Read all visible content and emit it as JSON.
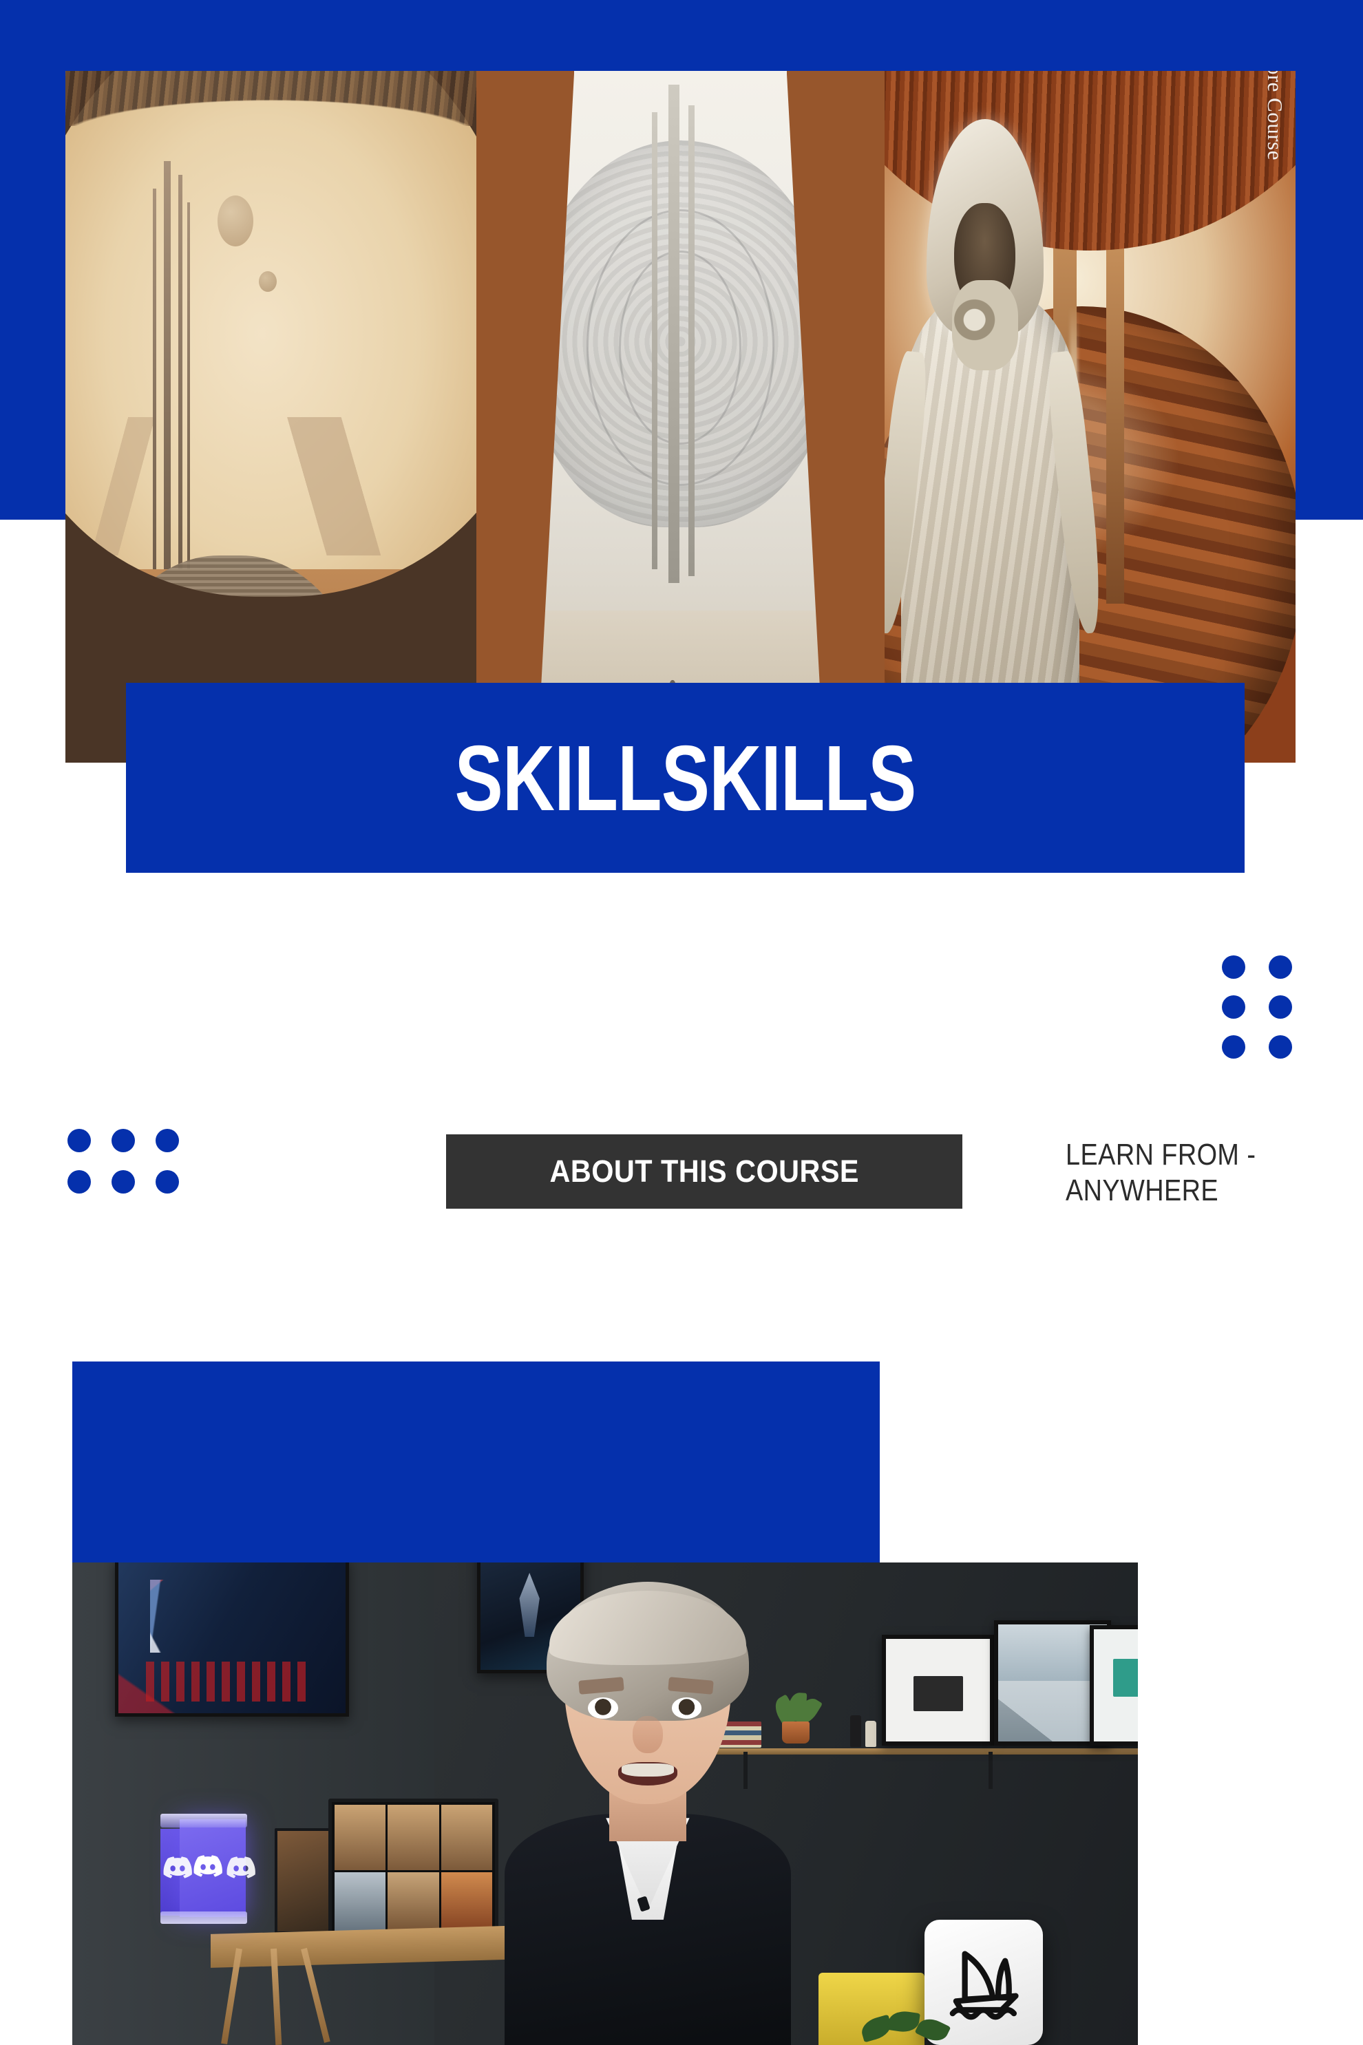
{
  "brand": {
    "name": "SKILLSKILLS",
    "accent_color": "#0530AC",
    "dark_color": "#333333"
  },
  "hero": {
    "watermark": "Skillskills.com For More Course",
    "image_alt": "Three-panel sci-fi desert collage: arched alien city, white megastructure, hooded robed figure before a red planet",
    "panels": [
      {
        "label": "desert-arch-city"
      },
      {
        "label": "white-megastructure"
      },
      {
        "label": "hooded-figure-mars"
      }
    ]
  },
  "title_banner": {
    "title": "SKILLSKILLS"
  },
  "section": {
    "about_label": "ABOUT THIS COURSE",
    "learn_text": "LEARN FROM - ANYWHERE"
  },
  "decor": {
    "dots_right": {
      "columns": 2,
      "rows": 3,
      "color": "#0530AC"
    },
    "dots_left": {
      "columns": 3,
      "rows": 2,
      "color": "#0530AC"
    }
  },
  "video": {
    "image_alt": "Presenter with short grey hair in a dark studio room speaking to camera",
    "overlays": [
      {
        "name": "discord-cube-lamp",
        "label": "Discord"
      },
      {
        "name": "midjourney-logo-card",
        "label": "Midjourney"
      }
    ]
  }
}
